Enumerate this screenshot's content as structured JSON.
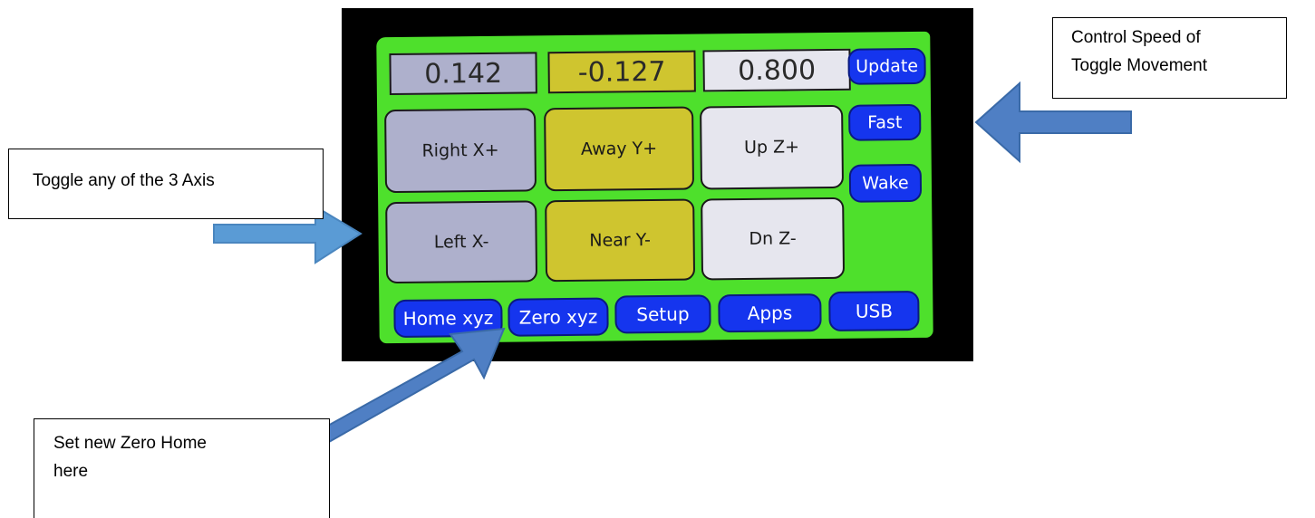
{
  "readouts": {
    "x": "0.142",
    "y": "-0.127",
    "z": "0.800"
  },
  "jog_buttons": {
    "right_x": "Right X+",
    "away_y": "Away Y+",
    "up_z": "Up Z+",
    "left_x": "Left X-",
    "near_y": "Near Y-",
    "dn_z": "Dn Z-"
  },
  "side_buttons": {
    "update": "Update",
    "fast": "Fast",
    "wake": "Wake"
  },
  "bottom_buttons": {
    "home": "Home xyz",
    "zero": "Zero xyz",
    "setup": "Setup",
    "apps": "Apps",
    "usb": "USB"
  },
  "callouts": {
    "speed_line1": "Control Speed of",
    "speed_line2": "Toggle Movement",
    "axis": "Toggle any of the 3 Axis",
    "zero_line1": "Set new Zero Home",
    "zero_line2": "here"
  },
  "colors": {
    "panel": "#4ee02c",
    "x_axis": "#aeb0cc",
    "y_axis": "#cfc52f",
    "z_axis": "#e6e6ee",
    "blue_button": "#1535ee",
    "arrow": "#4f7fc4"
  }
}
